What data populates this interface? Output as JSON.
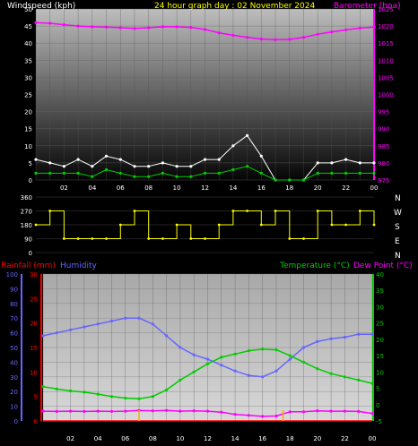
{
  "header": {
    "windspeed_label": "Windspeed (kph)",
    "title": "24 hour graph day : 02 November 2024",
    "barometer_label": "Barometer (hpa)"
  },
  "colors": {
    "wind_gust": "#ffffff",
    "wind_avg": "#00cc00",
    "barometer": "#ff00ff",
    "direction": "#ffff00",
    "rain": "#ff0000",
    "rain_tick": "#ffaa00",
    "humidity": "#6666ff",
    "temperature": "#00cc00",
    "dewpoint": "#ff00ff",
    "title": "#ffff00"
  },
  "x_ticks": [
    "02",
    "04",
    "06",
    "08",
    "10",
    "12",
    "14",
    "16",
    "18",
    "20",
    "22",
    "00"
  ],
  "direction_labels": [
    "N",
    "W",
    "S",
    "E",
    "N"
  ],
  "bottom_labels": {
    "rainfall": "Rainfall (mm)",
    "humidity": "Humidity",
    "temperature": "Temperature (°C)",
    "dewpoint": "Dew Point (°C)"
  },
  "chart_data": [
    {
      "type": "line",
      "title": "24 hour graph day : 02 November 2024",
      "xlabel": "",
      "ylabel": "Windspeed (kph)",
      "y2label": "Barometer (hpa)",
      "ylim": [
        0,
        50
      ],
      "y2lim": [
        975,
        1025
      ],
      "yticks": [
        0,
        5,
        10,
        15,
        20,
        25,
        30,
        35,
        40,
        45,
        50
      ],
      "y2ticks": [
        975,
        980,
        985,
        990,
        995,
        1000,
        1005,
        1010,
        1015,
        1020,
        1025
      ],
      "x": [
        0,
        1,
        2,
        3,
        4,
        5,
        6,
        7,
        8,
        9,
        10,
        11,
        12,
        13,
        14,
        15,
        16,
        17,
        18,
        19,
        20,
        21,
        22,
        23,
        24
      ],
      "series": [
        {
          "name": "Windspeed (kph)",
          "axis": "left",
          "role": "gust",
          "values": [
            6,
            5,
            4,
            6,
            4,
            7,
            6,
            4,
            4,
            5,
            4,
            4,
            6,
            6,
            10,
            13,
            7,
            0,
            0,
            0,
            5,
            5,
            6,
            5,
            5
          ]
        },
        {
          "name": "Windspeed (kph)",
          "axis": "left",
          "role": "average",
          "values": [
            2,
            2,
            2,
            2,
            1,
            3,
            2,
            1,
            1,
            2,
            1,
            1,
            2,
            2,
            3,
            4,
            2,
            0,
            0,
            0,
            2,
            2,
            2,
            2,
            2
          ]
        },
        {
          "name": "Barometer (hpa)",
          "axis": "right",
          "values": [
            1021,
            1020.8,
            1020.4,
            1020,
            1019.8,
            1019.7,
            1019.5,
            1019.3,
            1019.5,
            1019.8,
            1019.8,
            1019.6,
            1019,
            1018,
            1017.3,
            1016.7,
            1016.2,
            1016,
            1016.1,
            1016.7,
            1017.6,
            1018.3,
            1018.9,
            1019.4,
            1019.7
          ]
        }
      ]
    },
    {
      "type": "line",
      "title": "",
      "ylabel": "",
      "ylim": [
        0,
        360
      ],
      "yticks": [
        0,
        90,
        180,
        270,
        360
      ],
      "x": [
        0,
        1,
        2,
        3,
        4,
        5,
        6,
        7,
        8,
        9,
        10,
        11,
        12,
        13,
        14,
        15,
        16,
        17,
        18,
        19,
        20,
        21,
        22,
        23,
        24
      ],
      "series": [
        {
          "name": "",
          "values": [
            180,
            270,
            90,
            90,
            90,
            90,
            180,
            270,
            90,
            90,
            180,
            90,
            90,
            180,
            270,
            270,
            180,
            270,
            90,
            90,
            270,
            180,
            180,
            270,
            180
          ]
        }
      ]
    },
    {
      "type": "line",
      "title": "",
      "xlabel": "",
      "ylabel": "Rainfall (mm)",
      "ylim": [
        0,
        100
      ],
      "yticks": [
        0,
        10,
        20,
        30,
        40,
        50,
        60,
        70,
        80,
        90,
        100
      ],
      "rain_ylim": [
        0,
        30
      ],
      "rain_yticks": [
        0,
        5,
        10,
        15,
        20,
        25,
        30
      ],
      "temp_ylim": [
        -5,
        40
      ],
      "temp_yticks": [
        -5,
        0,
        5,
        10,
        15,
        20,
        25,
        30,
        35,
        40
      ],
      "x": [
        0,
        1,
        2,
        3,
        4,
        5,
        6,
        7,
        8,
        9,
        10,
        11,
        12,
        13,
        14,
        15,
        16,
        17,
        18,
        19,
        20,
        21,
        22,
        23,
        24
      ],
      "series": [
        {
          "name": "Humidity",
          "axis": "humidity",
          "values": [
            58,
            60,
            62,
            64,
            66,
            68,
            70,
            70,
            66,
            58,
            50,
            45,
            42,
            38,
            34,
            31,
            30,
            34,
            42,
            50,
            54,
            56,
            57,
            59,
            59
          ]
        },
        {
          "name": "Temperature (°C)",
          "axis": "temperature",
          "values": [
            5.5,
            4.8,
            4.2,
            3.8,
            3.2,
            2.5,
            2.0,
            1.8,
            2.5,
            4.5,
            7.5,
            10,
            12.5,
            14.5,
            15.5,
            16.5,
            17,
            16.8,
            15,
            13,
            11,
            9.5,
            8.5,
            7.5,
            6.5
          ]
        },
        {
          "name": "Dew Point (°C)",
          "axis": "temperature",
          "values": [
            -2,
            -2.1,
            -2,
            -2.1,
            -2,
            -2.1,
            -2.0,
            -1.8,
            -1.9,
            -1.8,
            -2.0,
            -1.9,
            -2.0,
            -2.3,
            -3.0,
            -3.3,
            -3.6,
            -3.5,
            -2.2,
            -2.2,
            -1.9,
            -2.0,
            -2.0,
            -2.1,
            -2.7
          ]
        },
        {
          "name": "Rainfall (mm)",
          "axis": "rain",
          "values": [
            0,
            0,
            0,
            0,
            0,
            0,
            0,
            0,
            0,
            0,
            0,
            0,
            0,
            0,
            0,
            0,
            0,
            0,
            0,
            0,
            0,
            0,
            0,
            0,
            0
          ]
        }
      ]
    }
  ]
}
